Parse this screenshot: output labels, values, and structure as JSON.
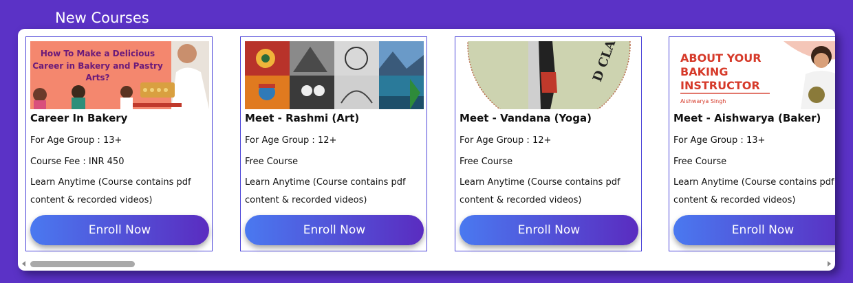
{
  "section": {
    "title": "New Courses"
  },
  "cards": [
    {
      "title": "Career In Bakery",
      "age": "For Age Group : 13+",
      "fee": "Course Fee : INR 450",
      "learn1": "Learn Anytime (Course contains pdf",
      "learn2": "content & recorded videos)",
      "button": "Enroll Now",
      "thumb_text": "How To Make a Delicious Career in Bakery and Pastry Arts?"
    },
    {
      "title": "Meet - Rashmi (Art)",
      "age": "For Age Group : 12+",
      "fee": "Free Course",
      "learn1": "Learn Anytime (Course contains pdf",
      "learn2": "content & recorded videos)",
      "button": "Enroll Now"
    },
    {
      "title": "Meet - Vandana (Yoga)",
      "age": "For Age Group : 12+",
      "fee": "Free Course",
      "learn1": "Learn Anytime (Course contains pdf",
      "learn2": "content & recorded videos)",
      "button": "Enroll Now",
      "thumb_text": "D CLASSY"
    },
    {
      "title": "Meet - Aishwarya (Baker)",
      "age": "For Age Group : 13+",
      "fee": "Free Course",
      "learn1": "Learn Anytime (Course contains pdf",
      "learn2": "content & recorded videos)",
      "button": "Enroll Now",
      "thumb_text_1": "ABOUT YOUR",
      "thumb_text_2": "BAKING",
      "thumb_text_3": "INSTRUCTOR",
      "thumb_caption": "Aishwarya Singh"
    }
  ],
  "colors": {
    "background": "#5b32c6",
    "card_border": "#4a43d8",
    "button_start": "#4a79f0",
    "button_end": "#5a2cc0"
  }
}
